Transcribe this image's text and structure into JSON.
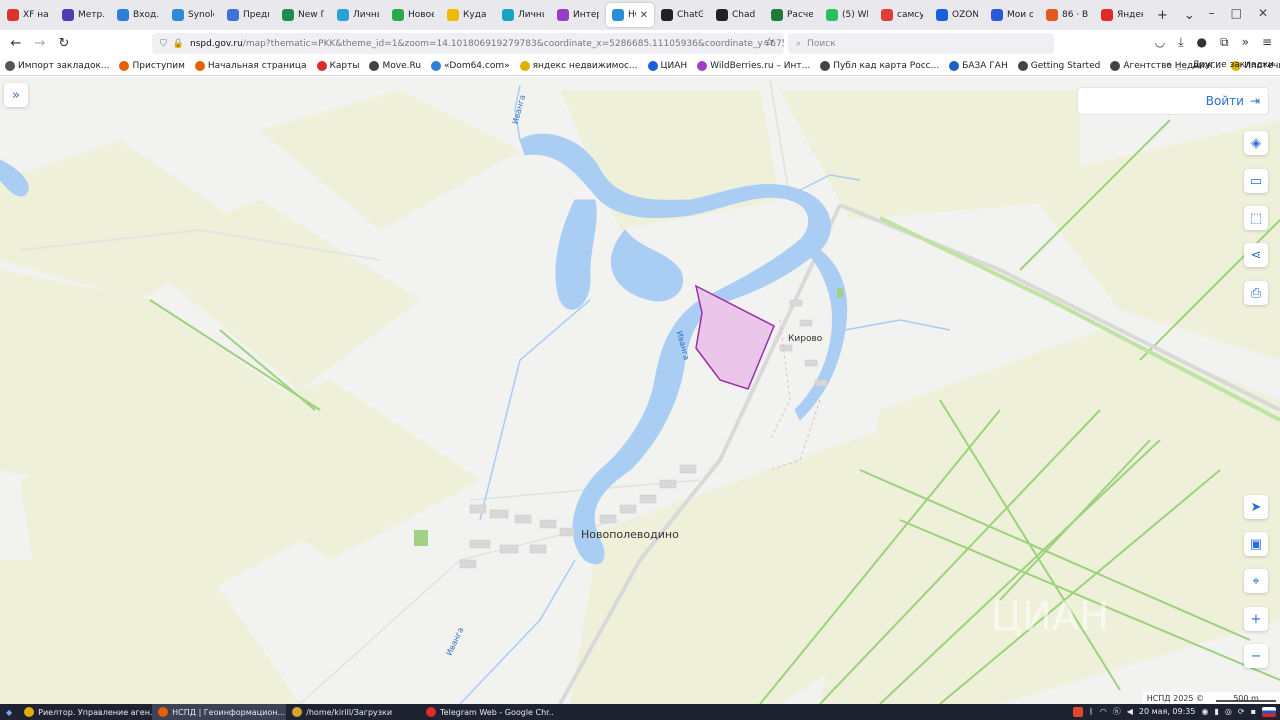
{
  "tabs": [
    {
      "label": "XF на ...",
      "color": "#d9352b"
    },
    {
      "label": "Метр...",
      "color": "#4c3fb5"
    },
    {
      "label": "Вход...",
      "color": "#2f7fd6"
    },
    {
      "label": "Synolo...",
      "color": "#2d8ad6"
    },
    {
      "label": "Предв...",
      "color": "#3e73d8"
    },
    {
      "label": "New Гр...",
      "color": "#1e8d4c"
    },
    {
      "label": "Личнь...",
      "color": "#28a3d8"
    },
    {
      "label": "Новое...",
      "color": "#2aa84a"
    },
    {
      "label": "Куда с...",
      "color": "#f0b800"
    },
    {
      "label": "Личны...",
      "color": "#19a4c2"
    },
    {
      "label": "Интер...",
      "color": "#9a3bc9"
    },
    {
      "label": "НСП",
      "color": "#2b8fd8",
      "active": true
    },
    {
      "label": "ChatG...",
      "color": "#222222"
    },
    {
      "label": "Chad А...",
      "color": "#222222"
    },
    {
      "label": "Расчет...",
      "color": "#1d7a3a"
    },
    {
      "label": "(5) Wh...",
      "color": "#25c160"
    },
    {
      "label": "самсу...",
      "color": "#e03c3c"
    },
    {
      "label": "OZON...",
      "color": "#1a5fdd"
    },
    {
      "label": "Мои о...",
      "color": "#2a59d8"
    },
    {
      "label": "86 · Вх...",
      "color": "#e25b1c"
    },
    {
      "label": "Яндек...",
      "color": "#e02a2a"
    }
  ],
  "nav": {
    "url_host": "nspd.gov.ru",
    "url_path": "/map?thematic=PKK&theme_id=1&zoom=14.101806919279783&coordinate_x=5286685.11105936&coordinate_y=6757756.4072008",
    "search_placeholder": "Поиск"
  },
  "bookmarks": [
    {
      "label": "Импорт закладок...",
      "color": "#555555"
    },
    {
      "label": "Приступим",
      "color": "#e66000"
    },
    {
      "label": "Начальная страница",
      "color": "#e66000"
    },
    {
      "label": "Карты",
      "color": "#e02a2a"
    },
    {
      "label": "Move.Ru",
      "color": "#444444"
    },
    {
      "label": "«Dom64.com»",
      "color": "#2f7fd6"
    },
    {
      "label": "яндекс недвижимос...",
      "color": "#e0b000"
    },
    {
      "label": "ЦИАН",
      "color": "#1a5fdd"
    },
    {
      "label": "WildBerries.ru – Инт...",
      "color": "#a43cc9"
    },
    {
      "label": "Публ кад карта Росс...",
      "color": "#444444"
    },
    {
      "label": "БАЗА ГАН",
      "color": "#2060c0"
    },
    {
      "label": "Getting Started",
      "color": "#444444"
    },
    {
      "label": "Агентство Недвиж...",
      "color": "#444444"
    },
    {
      "label": "Ипотечный калькул...",
      "color": "#e0b000"
    }
  ],
  "bookmarks_other": "Другие закладки",
  "map": {
    "login_label": "Войти",
    "places": {
      "village_kirovo": "Кирово",
      "village_novopolevodino": "Новополеводино"
    },
    "rivers": [
      "Иванга",
      "Иванга",
      "Иванга"
    ],
    "copyright": "НСПД 2025 ©",
    "scale_label": "500 m"
  },
  "taskbar": {
    "items": [
      {
        "label": "Риелтор. Управление аген...",
        "color": "#e0b000"
      },
      {
        "label": "НСПД | Геоинформацион...",
        "color": "#e66000",
        "active": true
      },
      {
        "label": "/home/kirill/Загрузки",
        "color": "#d8a32a"
      },
      {
        "label": "Telegram Web - Google Chr...",
        "color": "#e02a2a"
      }
    ],
    "datetime": "20 мая, 09:35"
  }
}
